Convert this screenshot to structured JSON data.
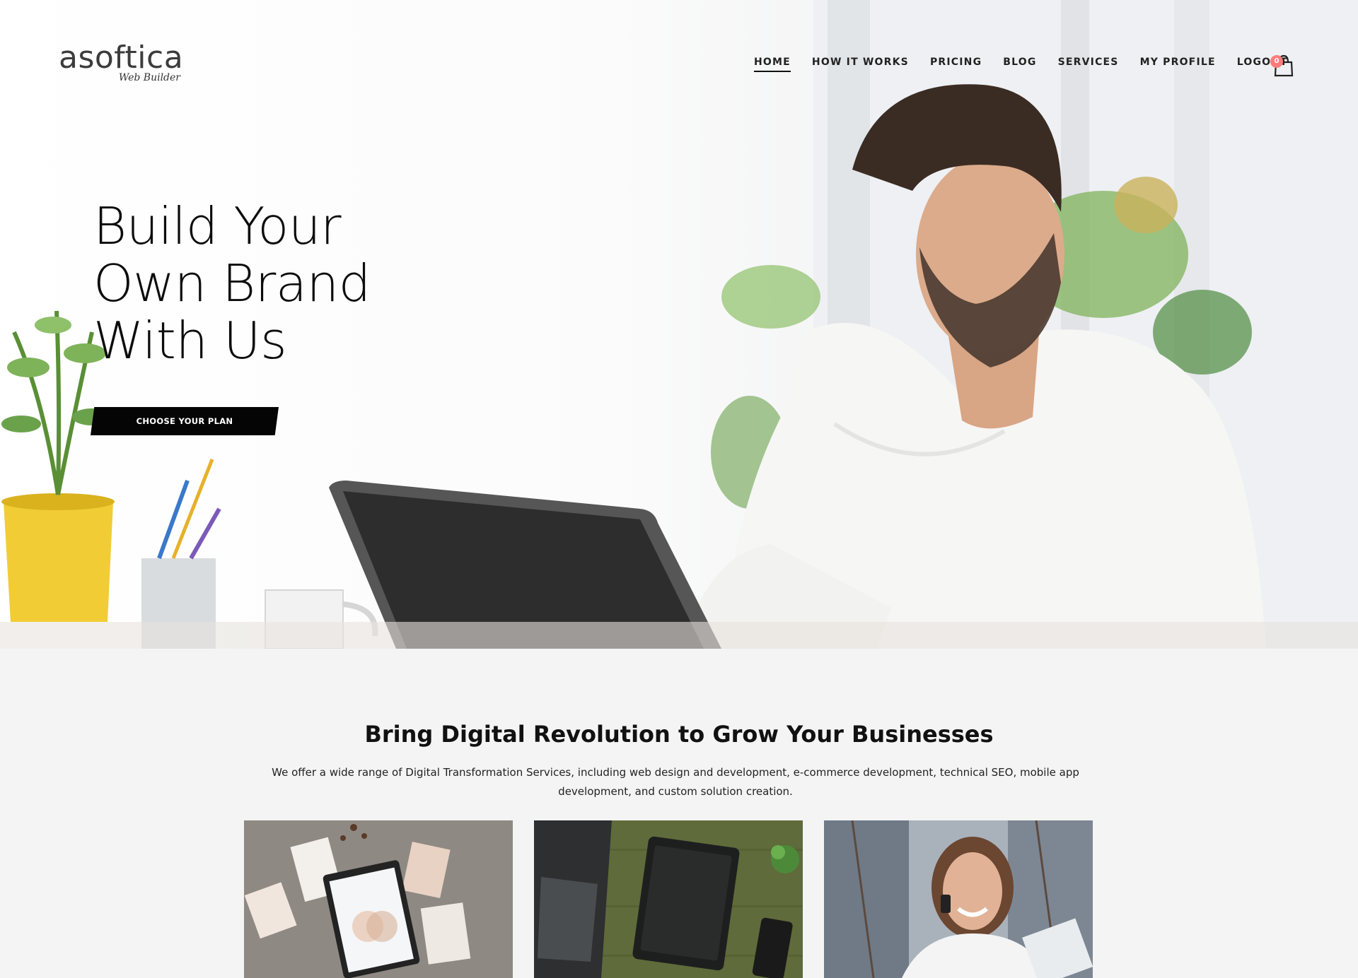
{
  "brand": {
    "name": "asoftica",
    "tagline": "Web Builder"
  },
  "nav": {
    "items": [
      {
        "label": "HOME",
        "active": true
      },
      {
        "label": "HOW IT WORKS",
        "active": false
      },
      {
        "label": "PRICING",
        "active": false
      },
      {
        "label": "BLOG",
        "active": false
      },
      {
        "label": "SERVICES",
        "active": false
      },
      {
        "label": "MY PROFILE",
        "active": false
      },
      {
        "label": "LOGOUT",
        "active": false
      }
    ],
    "cart": {
      "icon": "shopping-bag-icon",
      "count": "0",
      "badge_color": "#ff7a7a"
    }
  },
  "hero": {
    "title_lines": [
      "Build Your",
      "Own Brand",
      "With Us"
    ],
    "cta_label": "CHOOSE YOUR PLAN"
  },
  "section": {
    "title": "Bring Digital Revolution to Grow Your Businesses",
    "description": "We offer a wide range of Digital Transformation Services, including web design and development, e-commerce development, technical SEO, mobile app development, and custom solution creation."
  },
  "colors": {
    "accent": "#050505",
    "background": "#f4f4f4",
    "text": "#111111"
  }
}
